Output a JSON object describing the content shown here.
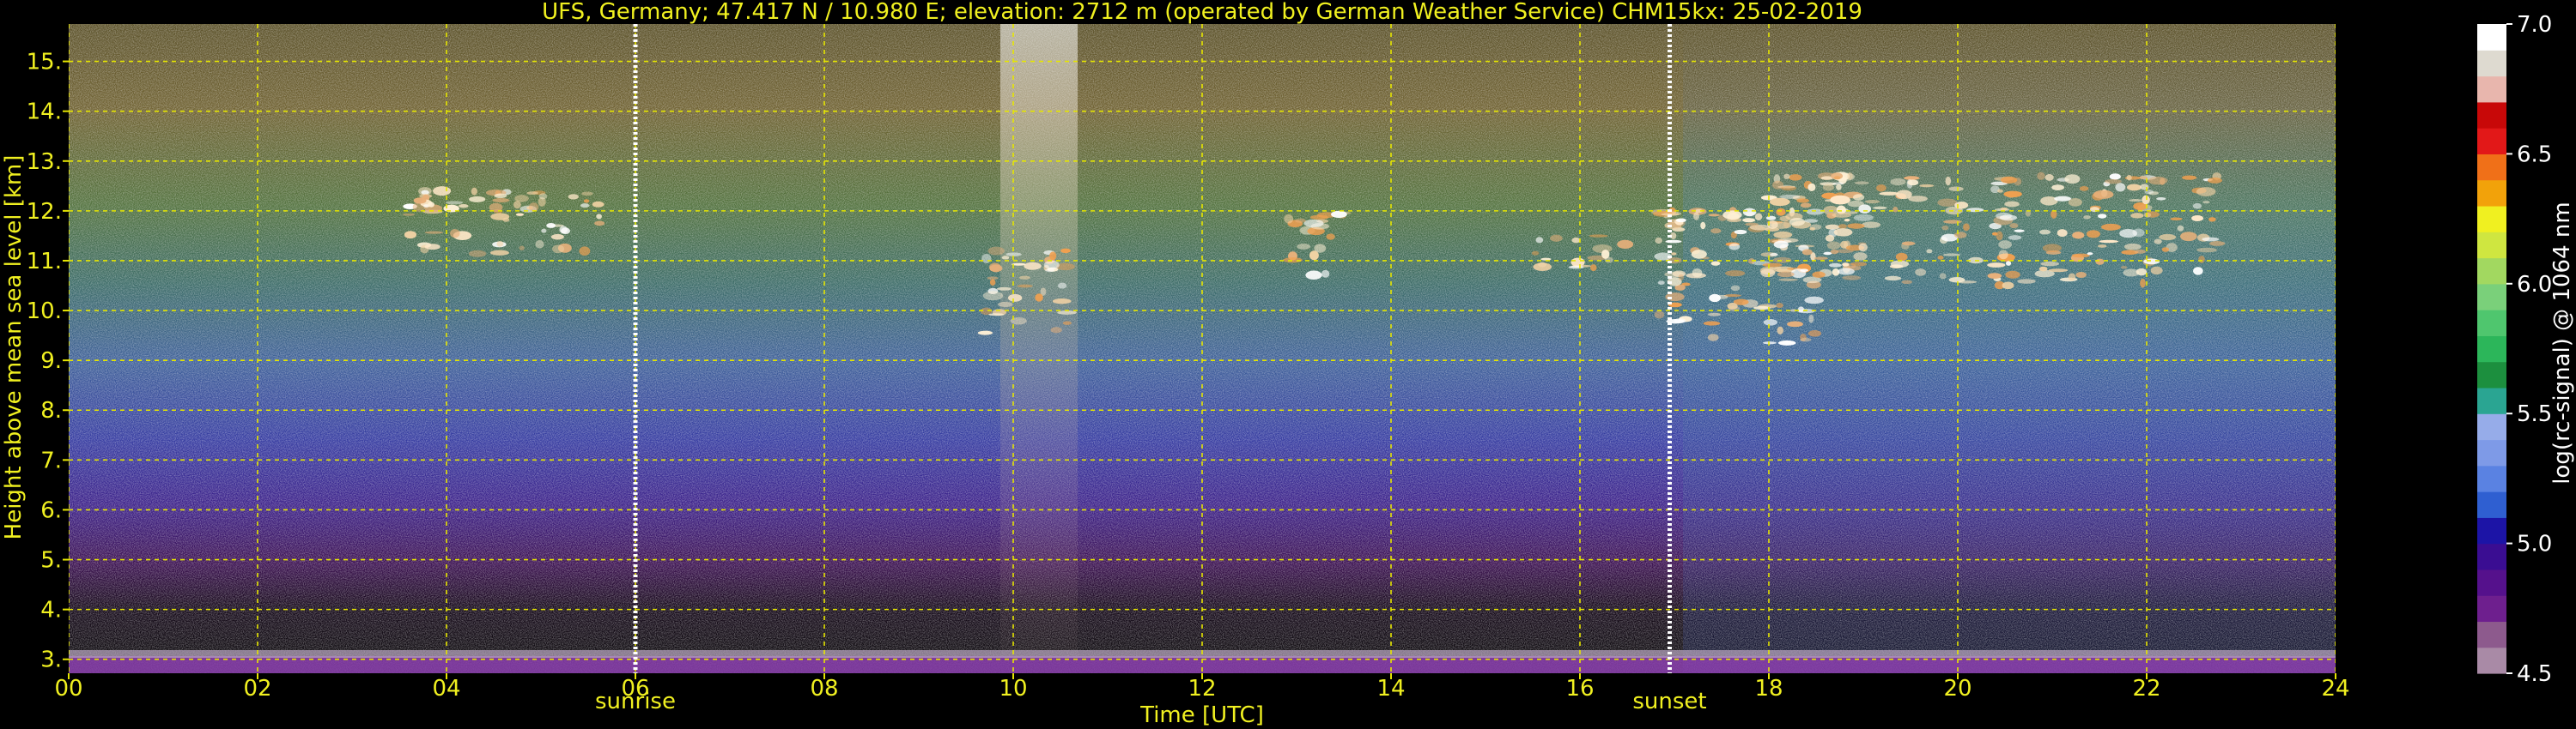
{
  "chart_data": {
    "type": "heatmap",
    "title": "UFS, Germany; 47.417 N / 10.980 E; elevation: 2712 m  (operated by German Weather Service)    CHM15kx: 25-02-2019",
    "xlabel": "Time [UTC]",
    "ylabel": "Height above mean sea level [km]",
    "x_ticks": [
      "00",
      "02",
      "04",
      "06",
      "08",
      "10",
      "12",
      "14",
      "16",
      "18",
      "20",
      "22",
      "24"
    ],
    "xlim": [
      0,
      24
    ],
    "y_ticks": [
      "3.",
      "4.",
      "5.",
      "6.",
      "7.",
      "8.",
      "9.",
      "10.",
      "11.",
      "12.",
      "13.",
      "14.",
      "15."
    ],
    "ylim": [
      2.72,
      15.75
    ],
    "grid": true,
    "annotations": [
      {
        "label": "sunrise",
        "x": 6.0
      },
      {
        "label": "sunset",
        "x": 16.95
      }
    ],
    "colorbar": {
      "label": "log(rc-signal) @ 1064 nm",
      "range": [
        4.5,
        7.0
      ],
      "tick_labels": [
        "4.5",
        "5.0",
        "5.5",
        "6.0",
        "6.5",
        "7.0"
      ],
      "colors": [
        "#a98aa6",
        "#8d5a8d",
        "#6e1f8e",
        "#55118c",
        "#3a0d92",
        "#1c14a6",
        "#2f5fd1",
        "#5a82e2",
        "#7e9ae7",
        "#96ace9",
        "#2aa592",
        "#1c8f3e",
        "#2cb65a",
        "#4fc66e",
        "#7ad07a",
        "#a2d860",
        "#cfe640",
        "#f0f020",
        "#f2a20a",
        "#f07018",
        "#e21818",
        "#c80808",
        "#e8b6ad",
        "#dedad0",
        "#ffffff"
      ]
    },
    "cloud_layers": [
      {
        "x_start": 3.6,
        "x_end": 5.7,
        "height_min": 11.1,
        "height_max": 12.4
      },
      {
        "x_start": 9.7,
        "x_end": 10.6,
        "height_min": 9.5,
        "height_max": 11.2
      },
      {
        "x_start": 12.9,
        "x_end": 13.5,
        "height_min": 10.6,
        "height_max": 12.0
      },
      {
        "x_start": 15.5,
        "x_end": 16.5,
        "height_min": 10.8,
        "height_max": 11.5
      },
      {
        "x_start": 16.8,
        "x_end": 18.5,
        "height_min": 9.3,
        "height_max": 12.0
      },
      {
        "x_start": 18.0,
        "x_end": 22.8,
        "height_min": 10.5,
        "height_max": 12.7
      }
    ]
  }
}
